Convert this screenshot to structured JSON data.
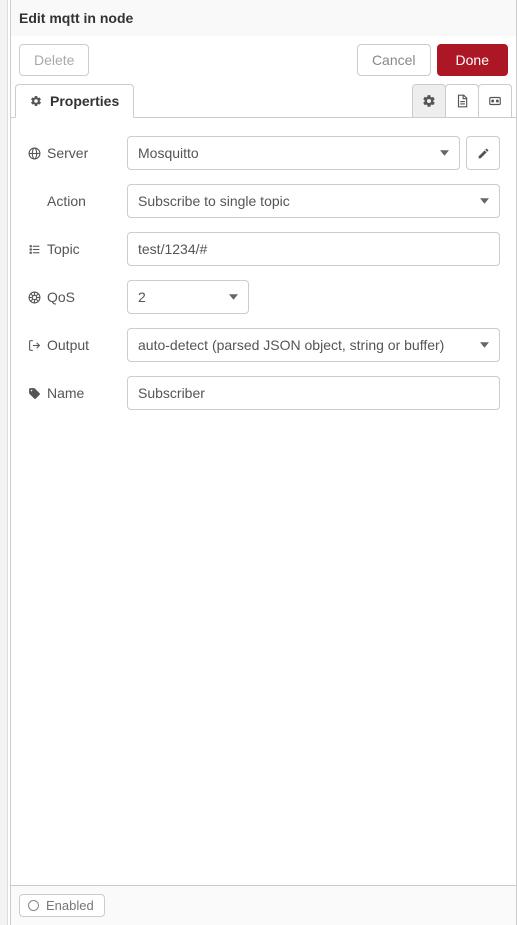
{
  "header": {
    "title": "Edit mqtt in node"
  },
  "toolbar": {
    "delete_label": "Delete",
    "cancel_label": "Cancel",
    "done_label": "Done"
  },
  "tabs": {
    "properties_label": "Properties"
  },
  "form": {
    "server": {
      "label": "Server",
      "value": "Mosquitto"
    },
    "action": {
      "label": "Action",
      "value": "Subscribe to single topic"
    },
    "topic": {
      "label": "Topic",
      "value": "test/1234/#"
    },
    "qos": {
      "label": "QoS",
      "value": "2"
    },
    "output": {
      "label": "Output",
      "value": "auto-detect (parsed JSON object, string or buffer)"
    },
    "name": {
      "label": "Name",
      "value": "Subscriber",
      "placeholder": "Name"
    }
  },
  "footer": {
    "enabled_label": "Enabled"
  }
}
